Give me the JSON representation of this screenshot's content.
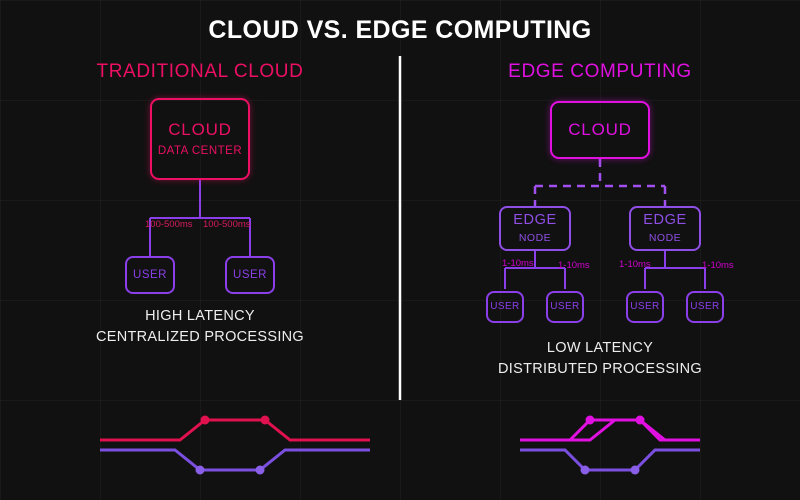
{
  "title": "CLOUD VS. EDGE COMPUTING",
  "colors": {
    "background": "#111111",
    "title": "#ffffff",
    "traditional_accent": "#ec0f63",
    "edge_accent": "#e010e0",
    "node_purple": "#8a3fe8",
    "divider": "#ffffff"
  },
  "panels": {
    "left": {
      "heading": "TRADITIONAL CLOUD",
      "cloud": {
        "title": "CLOUD",
        "subtitle": "DATA CENTER"
      },
      "latency_labels": [
        "100-500ms",
        "100-500ms"
      ],
      "users": [
        {
          "label": "USER"
        },
        {
          "label": "USER"
        }
      ],
      "caption_line1": "HIGH LATENCY",
      "caption_line2": "CENTRALIZED PROCESSING"
    },
    "right": {
      "heading": "EDGE COMPUTING",
      "cloud": {
        "title": "CLOUD"
      },
      "edge_nodes": [
        {
          "title": "EDGE",
          "subtitle": "NODE"
        },
        {
          "title": "EDGE",
          "subtitle": "NODE"
        }
      ],
      "latency_labels": [
        "1-10ms",
        "1-10ms",
        "1-10ms",
        "1-10ms"
      ],
      "users": [
        {
          "label": "USER"
        },
        {
          "label": "USER"
        },
        {
          "label": "USER"
        },
        {
          "label": "USER"
        }
      ],
      "caption_line1": "LOW LATENCY",
      "caption_line2": "DISTRIBUTED PROCESSING"
    }
  },
  "footer_waveforms": {
    "left": {
      "high_series_color": "#e0114f",
      "low_series_color": "#7b4fe0"
    },
    "right": {
      "high_series_color": "#e010e0",
      "low_series_color": "#7b4fe0"
    }
  }
}
